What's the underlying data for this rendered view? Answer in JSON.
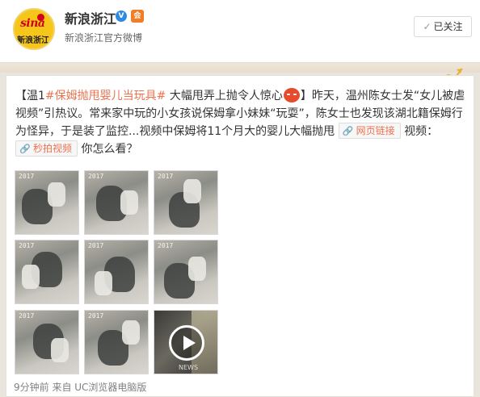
{
  "header": {
    "user_name": "新浪浙江",
    "verified_badge": "V",
    "member_badge": "会",
    "description": "新浪浙江官方微博",
    "avatar_brand": "sina",
    "avatar_subtitle": "新浪浙江",
    "follow_button": {
      "check": "✓",
      "label": "已关注"
    }
  },
  "post": {
    "text": {
      "open_bracket": "【",
      "city": "温1",
      "hashtag": "#保姆抛甩婴儿当玩具#",
      "headline": " 大幅甩弄上抛令人惊心",
      "close_bracket": "】",
      "body1": "昨天，温州陈女士发“女儿被虐视频”引热议。常来家中玩的小女孩说保姆拿小妹妹“玩耍”，陈女士也发现该湖北籍保姆行为怪异，于是装了监控...视频中保姆将11个月大的婴儿大幅抛甩 ",
      "link_web": "网页链接",
      "body2": " 视频：",
      "link_video": "秒拍视频",
      "body3": " 你怎么看？",
      "emoji": "angry-face-emoji"
    },
    "thumbnails_stamp": "2017",
    "video_watermark": "NEWS",
    "meta": "9分钟前 来自 UC浏览器电脑版"
  },
  "colors": {
    "accent": "#eb7350",
    "verified": "#2d8ae2",
    "avatar": "#f7c61a"
  }
}
